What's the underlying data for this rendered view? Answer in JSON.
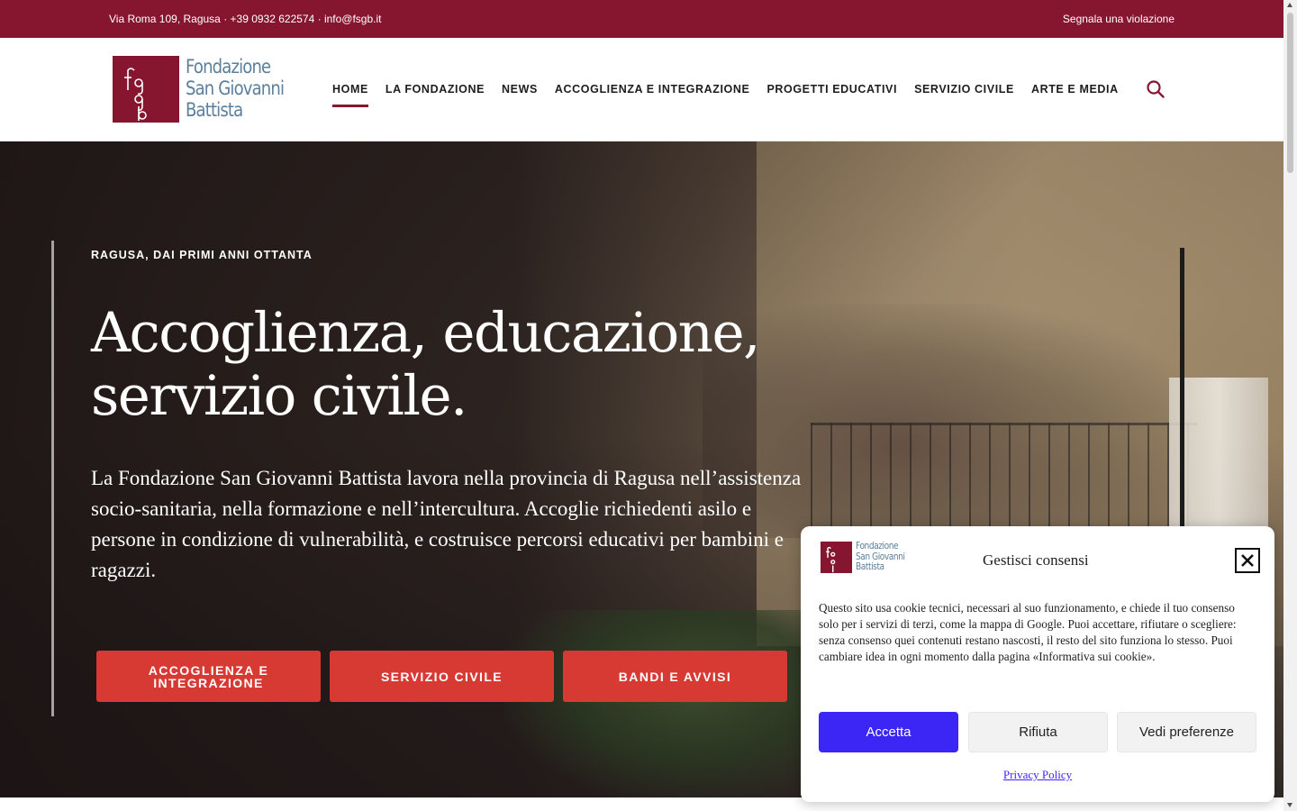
{
  "topbar": {
    "contacts": "Via Roma 109, Ragusa · +39 0932 622574 · info@fsgb.it",
    "report_link": "Segnala una violazione"
  },
  "header": {
    "logo_lines": [
      "Fondazione",
      "San Giovanni",
      "Battista"
    ],
    "logo_monogram": "fsgb",
    "nav": [
      {
        "label": "HOME",
        "active": true
      },
      {
        "label": "LA FONDAZIONE",
        "active": false
      },
      {
        "label": "NEWS",
        "active": false
      },
      {
        "label": "ACCOGLIENZA E INTEGRAZIONE",
        "active": false
      },
      {
        "label": "PROGETTI EDUCATIVI",
        "active": false
      },
      {
        "label": "SERVIZIO CIVILE",
        "active": false
      },
      {
        "label": "ARTE E MEDIA",
        "active": false
      }
    ],
    "search_icon": "search-icon"
  },
  "hero": {
    "eyebrow": "RAGUSA, DAI PRIMI ANNI OTTANTA",
    "headline_line1": "Accoglienza, educazione,",
    "headline_line2": "servizio civile.",
    "intro": "La Fondazione San Giovanni Battista lavora nella provincia di Ragusa nell’assistenza socio-sanitaria, nella formazione e nell’intercultura. Accoglie richiedenti asilo e persone in condizione di vulnerabilità, e costruisce percorsi educativi per bambini e ragazzi.",
    "buttons": [
      {
        "label": "ACCOGLIENZA E INTEGRAZIONE"
      },
      {
        "label": "SERVIZIO CIVILE"
      },
      {
        "label": "BANDI E AVVISI"
      }
    ]
  },
  "cookie": {
    "title": "Gestisci consensi",
    "body": "Questo sito usa cookie tecnici, necessari al suo funzionamento, e chiede il tuo consenso solo per i servizi di terzi, come la mappa di Google. Puoi accettare, rifiutare o scegliere: senza consenso quei contenuti restano nascosti, il resto del sito funziona lo stesso. Puoi cambiare idea in ogni momento dalla pagina «Informativa sui cookie».",
    "accept": "Accetta",
    "deny": "Rifiuta",
    "preferences": "Vedi preferenze",
    "policy_link": "Privacy Policy",
    "close_icon": "close-icon"
  },
  "colors": {
    "brand": "#861530",
    "logo_text": "#5b7f9c",
    "cta": "#d63a33",
    "accept": "#3c26f5"
  }
}
